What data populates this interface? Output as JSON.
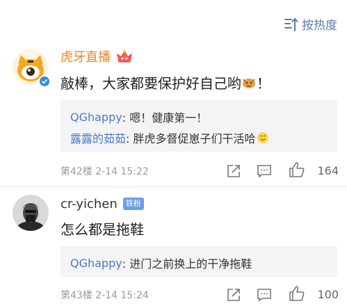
{
  "sort": {
    "label": "按热度"
  },
  "comments": [
    {
      "user": "虎牙直播",
      "text_before": "敲棒，大家都要保护好自己哟",
      "text_after": "！",
      "replies": [
        {
          "user": "QGhappy",
          "text": ": 嗯！健康第一！"
        },
        {
          "user": "露露的茹茹",
          "text": ": 胖虎多督促崽子们干活哈"
        }
      ],
      "meta": "第42楼  2-14 15:22",
      "likes": "164",
      "colors": {
        "name": "#f5831f"
      }
    },
    {
      "user": "cr-yichen",
      "badge": "铁粉",
      "text_before": "怎么都是拖鞋",
      "replies": [
        {
          "user": "QGhappy",
          "text": ": 进门之前换上的干净拖鞋"
        }
      ],
      "meta": "第43楼  2-14 15:24",
      "likes": "100"
    }
  ],
  "colors": {
    "link": "#4a7bbf",
    "sort": "#5b7ca8",
    "verified": "#2b8ee8",
    "badge": "#6a9ee8"
  }
}
